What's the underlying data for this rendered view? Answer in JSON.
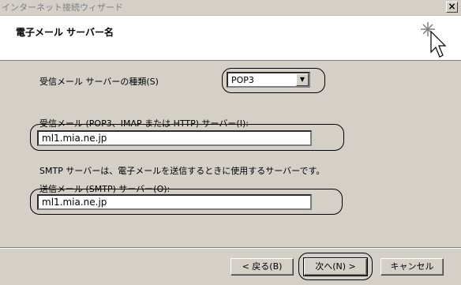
{
  "window": {
    "title": "インターネット接続ウィザード",
    "close_glyph": "×"
  },
  "header": {
    "title": "電子メール サーバー名"
  },
  "incoming_type": {
    "label": "受信メール サーバーの種類(S)",
    "selected": "POP3",
    "arrow_glyph": "▼"
  },
  "incoming_server": {
    "label": "受信メール (POP3、IMAP または HTTP) サーバー(I):",
    "value": "ml1.mia.ne.jp"
  },
  "smtp_note": "SMTP サーバーは、電子メールを送信するときに使用するサーバーです。",
  "outgoing_server": {
    "label": "送信メール (SMTP) サーバー(O):",
    "value": "ml1.mia.ne.jp"
  },
  "buttons": {
    "back": "< 戻る(B)",
    "next": "次へ(N) >",
    "cancel": "キャンセル"
  }
}
